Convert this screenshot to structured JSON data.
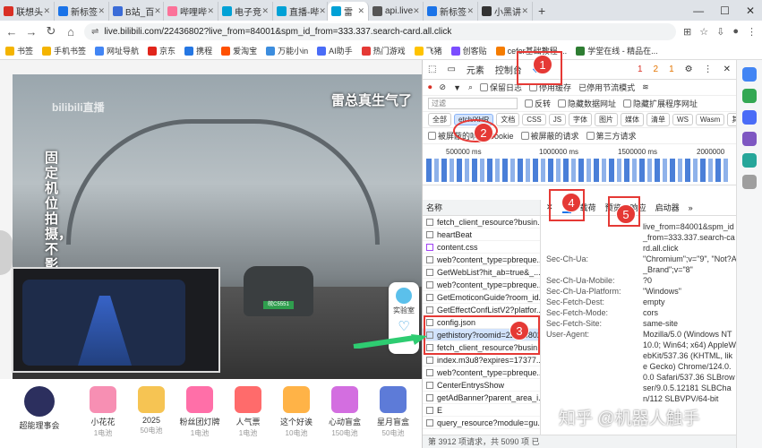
{
  "browser": {
    "tabs": [
      {
        "label": "联想头",
        "color": "#d93025"
      },
      {
        "label": "新标签",
        "color": "#1a73e8"
      },
      {
        "label": "B站_百",
        "color": "#3b6cd8"
      },
      {
        "label": "哔哩哔",
        "color": "#fb7299"
      },
      {
        "label": "电子竞",
        "color": "#00a1d6"
      },
      {
        "label": "直播-哔",
        "color": "#00a1d6"
      },
      {
        "label": "雷",
        "color": "#00a1d6"
      },
      {
        "label": "api.live",
        "color": "#555555"
      },
      {
        "label": "新标签",
        "color": "#1a73e8"
      },
      {
        "label": "小黑讲",
        "color": "#333333"
      }
    ],
    "url": "live.bilibili.com/22436802?live_from=84001&spm_id_from=333.337.search-card.all.click",
    "bookmarks": [
      "书签",
      "手机书签",
      "网址导航",
      "京东",
      "携程",
      "爱淘宝",
      "万能小in",
      "AI助手",
      "热门游戏",
      "飞猪",
      "创客贴",
      "cefer基础教程·...",
      "学堂在线 - 精品在..."
    ]
  },
  "page": {
    "video_title": "雷总真生气了",
    "vertical_text": "固定机位拍摄，不影响驾驶",
    "watermark_logo": "bilibili直播",
    "plate": "皖C5551",
    "side_panel_label": "实验室",
    "gifts": [
      {
        "name": "超能理事会",
        "sub": "",
        "color": "#2c2f5e"
      },
      {
        "name": "小花花",
        "sub": "1电池",
        "color": "#f78fb3"
      },
      {
        "name": "2025",
        "sub": "50电池",
        "color": "#f6c453"
      },
      {
        "name": "粉丝团灯牌",
        "sub": "1电池",
        "color": "#ff6fa8"
      },
      {
        "name": "人气票",
        "sub": "1电池",
        "color": "#ff6b6b"
      },
      {
        "name": "这个好诶",
        "sub": "10电池",
        "color": "#ffb347"
      },
      {
        "name": "心动盲盒",
        "sub": "150电池",
        "color": "#d36ee0"
      },
      {
        "name": "星月盲盒",
        "sub": "50电池",
        "color": "#5d7bd8"
      }
    ]
  },
  "devtools": {
    "top_tabs": [
      "元素",
      "控制台"
    ],
    "badges": {
      "errors": "1",
      "warnings": "2",
      "info": "1"
    },
    "toolbar": {
      "preserve_log": "保留日志",
      "disable_cache": "停用缓存",
      "throttle": "已停用节流模式"
    },
    "filter": {
      "placeholder": "过滤",
      "invert": "反转",
      "hide_data": "隐藏数据网址",
      "hide_ext": "隐藏扩展程序网址"
    },
    "type_filters": [
      "全部",
      "etch/XHR",
      "文档",
      "CSS",
      "JS",
      "字体",
      "图片",
      "媒体",
      "清单",
      "WS",
      "Wasm",
      "其他"
    ],
    "options": {
      "blocked_cookies": "被屏蔽的响应 Cookie",
      "blocked_requests": "被屏蔽的请求",
      "third_party": "第三方请求"
    },
    "timeline_ticks": [
      "500000 ms",
      "1000000 ms",
      "1500000 ms",
      "2000000"
    ],
    "name_header": "名称",
    "requests": [
      "fetch_client_resource?busin...",
      "heartBeat",
      "content.css",
      "web?content_type=pbreque...",
      "GetWebList?hit_ab=true&_...",
      "web?content_type=pbreque...",
      "GetEmoticonGuide?room_id...",
      "GetEffectConfListV2?platfor...",
      "config.json",
      "gethistory?roomid=22436802",
      "fetch_client_resource?busin...",
      "index.m3u8?expires=17377...",
      "web?content_type=pbreque...",
      "CenterEntrysShow",
      "getAdBanner?parent_area_i...",
      "E",
      "query_resource?module=gu..."
    ],
    "detail_tabs": [
      "载荷",
      "预览",
      "响应",
      "启动器"
    ],
    "headers": [
      {
        "k": "",
        "v": "live_from=84001&spm_id_from=333.337.search-card.all.click"
      },
      {
        "k": "Sec-Ch-Ua:",
        "v": "\"Chromium\";v=\"9\", \"Not?A_Brand\";v=\"8\""
      },
      {
        "k": "Sec-Ch-Ua-Mobile:",
        "v": "?0"
      },
      {
        "k": "Sec-Ch-Ua-Platform:",
        "v": "\"Windows\""
      },
      {
        "k": "Sec-Fetch-Dest:",
        "v": "empty"
      },
      {
        "k": "Sec-Fetch-Mode:",
        "v": "cors"
      },
      {
        "k": "Sec-Fetch-Site:",
        "v": "same-site"
      },
      {
        "k": "User-Agent:",
        "v": "Mozilla/5.0 (Windows NT 10.0; Win64; x64) AppleWebKit/537.36 (KHTML, like Gecko) Chrome/124.0.0.0 Safari/537.36 SLBrowser/9.0.5.12181 SLBChan/112 SLBVPV/64-bit"
      }
    ],
    "status": "第 3912 项请求，共 5090 项  已"
  },
  "annotations": [
    "1",
    "2",
    "3",
    "4",
    "5"
  ],
  "watermark": "知乎 @机器人触手"
}
